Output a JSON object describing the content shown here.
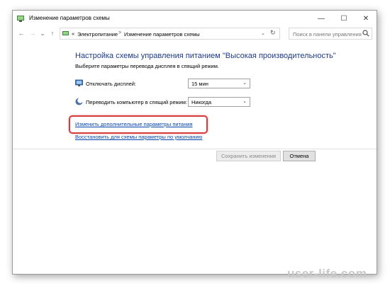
{
  "window": {
    "title": "Изменение параметров схемы",
    "controls": {
      "minimize": "—",
      "maximize": "☐",
      "close": "✕"
    }
  },
  "address": {
    "nav": {
      "back": "←",
      "forward": "→",
      "dropdown": "⌄",
      "up": "↑"
    },
    "crumb_prefix": "«",
    "crumbs": [
      "Электропитание",
      "Изменение параметров схемы"
    ],
    "separator": ">",
    "history_arrow": "⌄",
    "refresh": "↻",
    "search_placeholder": "Поиск в панели управления",
    "search_icon": "search-icon"
  },
  "main": {
    "heading": "Настройка схемы управления питанием \"Высокая производительность\"",
    "subtext": "Выберите параметры перевода дисплея в спящий режим.",
    "rows": [
      {
        "label": "Отключать дисплей:",
        "value": "15 мин",
        "icon": "monitor-icon"
      },
      {
        "label": "Переводить компьютер в спящий режим:",
        "value": "Никогда",
        "icon": "moon-icon"
      }
    ],
    "links": {
      "advanced": "Изменить дополнительные параметры питания",
      "restore": "Восстановить для схемы параметры по умолчанию"
    },
    "buttons": {
      "save": "Сохранить изменения",
      "cancel": "Отмена"
    }
  },
  "watermark": "user-life.com",
  "colors": {
    "heading": "#1e3a8a",
    "link": "#0645ad",
    "highlight": "#d43c3c"
  }
}
